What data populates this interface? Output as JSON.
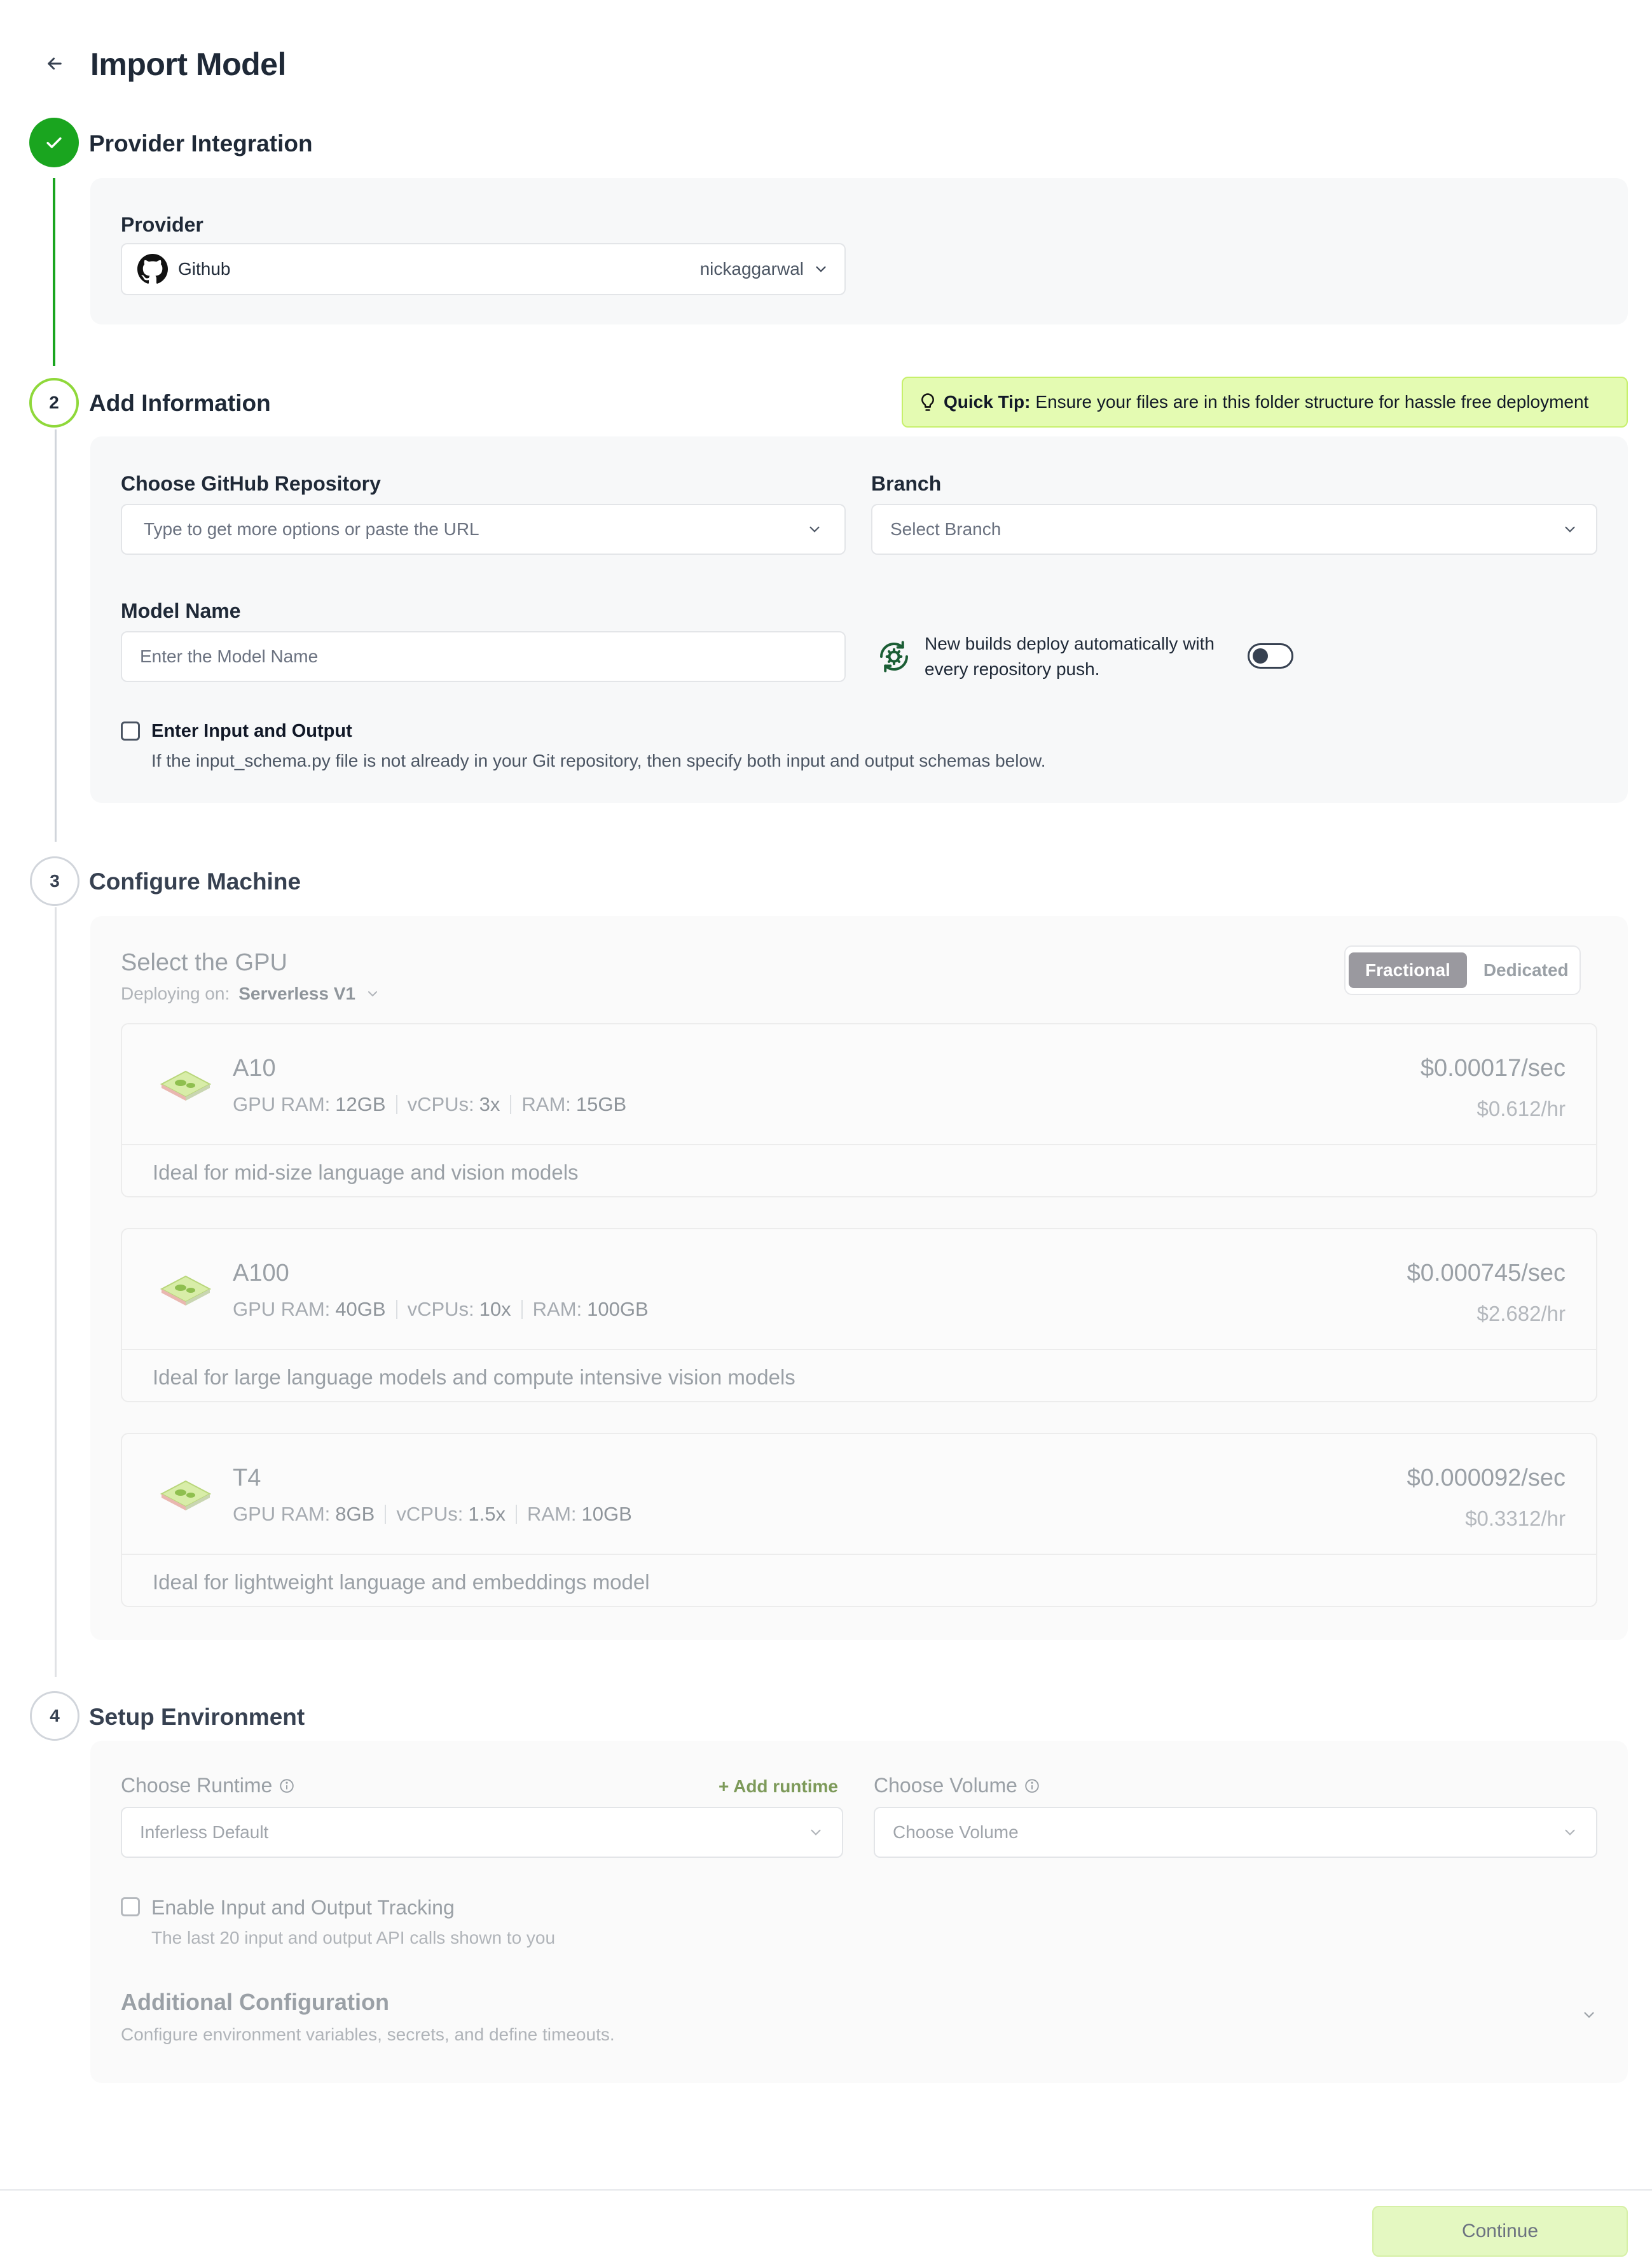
{
  "page": {
    "title": "Import Model"
  },
  "steps": {
    "provider": {
      "label": "Provider Integration"
    },
    "info": {
      "number": "2",
      "label": "Add Information"
    },
    "machine": {
      "number": "3",
      "label": "Configure Machine"
    },
    "env": {
      "number": "4",
      "label": "Setup Environment"
    }
  },
  "provider": {
    "field_label": "Provider",
    "name": "Github",
    "account": "nickaggarwal",
    "icon": "github-icon"
  },
  "tip": {
    "prefix": "Quick Tip:",
    "text": "Ensure your files are in this folder structure for hassle free deployment"
  },
  "info": {
    "repo_label": "Choose GitHub Repository",
    "repo_placeholder": "Type to get more options or paste the URL",
    "branch_label": "Branch",
    "branch_placeholder": "Select Branch",
    "model_name_label": "Model Name",
    "model_name_placeholder": "Enter the Model Name",
    "auto_deploy_text": "New builds deploy automatically with every repository push.",
    "io_checkbox_label": "Enter Input and Output",
    "io_help": "If the input_schema.py file is not already in your Git repository, then specify both input and output schemas below."
  },
  "machine": {
    "title": "Select the GPU",
    "deploying_on_label": "Deploying on:",
    "deploying_on_value": "Serverless V1",
    "segments": [
      "Fractional",
      "Dedicated"
    ],
    "selected_segment": "Fractional",
    "spec_labels": {
      "gpu_ram": "GPU RAM:",
      "vcpus": "vCPUs:",
      "ram": "RAM:"
    },
    "gpus": [
      {
        "name": "A10",
        "gpu_ram": "12GB",
        "vcpus": "3x",
        "ram": "15GB",
        "price_sec": "$0.00017/sec",
        "price_hr": "$0.612/hr",
        "description": "Ideal for mid-size language and vision models"
      },
      {
        "name": "A100",
        "gpu_ram": "40GB",
        "vcpus": "10x",
        "ram": "100GB",
        "price_sec": "$0.000745/sec",
        "price_hr": "$2.682/hr",
        "description": "Ideal for large language models and compute intensive vision models"
      },
      {
        "name": "T4",
        "gpu_ram": "8GB",
        "vcpus": "1.5x",
        "ram": "10GB",
        "price_sec": "$0.000092/sec",
        "price_hr": "$0.3312/hr",
        "description": "Ideal for lightweight language and embeddings model"
      }
    ]
  },
  "env": {
    "runtime_label": "Choose Runtime",
    "add_runtime": "+ Add runtime",
    "runtime_value": "Inferless Default",
    "volume_label": "Choose Volume",
    "volume_placeholder": "Choose Volume",
    "tracking_label": "Enable Input and Output Tracking",
    "tracking_help": "The last 20 input and output API calls shown to you",
    "additional_title": "Additional Configuration",
    "additional_help": "Configure environment variables, secrets, and define timeouts."
  },
  "footer": {
    "continue": "Continue"
  },
  "colors": {
    "success": "#1aa51f",
    "active_ring": "#8fd83a",
    "tip_bg": "#e4fbb2",
    "continue_bg": "#e4f8c1"
  }
}
